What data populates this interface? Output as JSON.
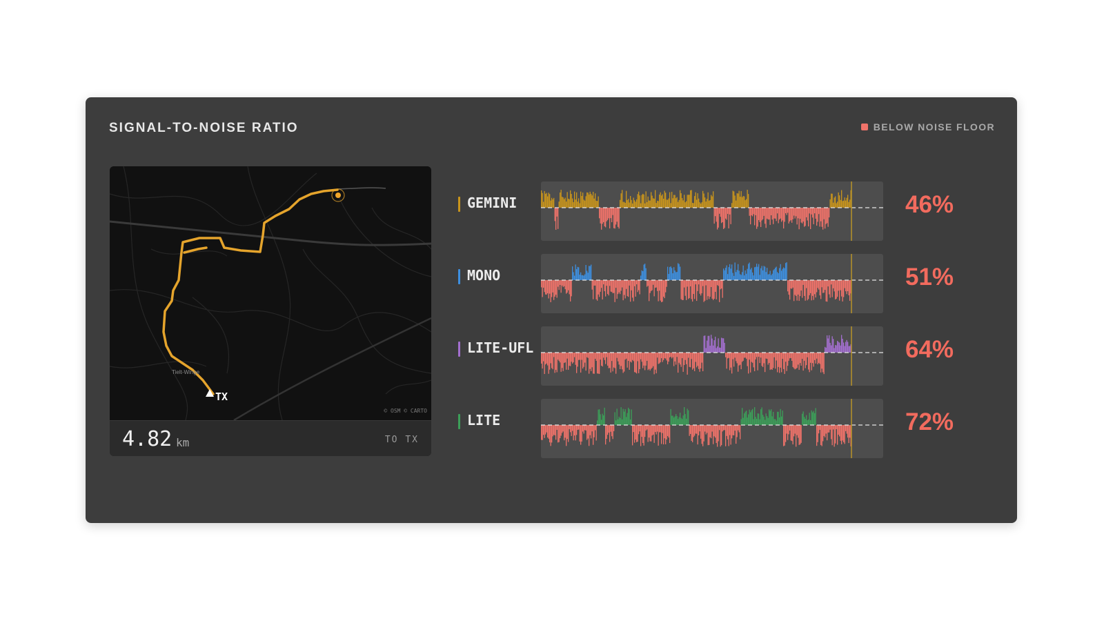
{
  "title": "SIGNAL-TO-NOISE RATIO",
  "legend": {
    "label": "BELOW NOISE FLOOR",
    "color": "#f0736a"
  },
  "map": {
    "distance": "4.82",
    "unit": "km",
    "to_label": "TO TX",
    "tx_label": "TX",
    "attribution": "© OSM © CARTO",
    "town_label": "Tielt-Winge",
    "route_color": "#e5a42c"
  },
  "rows": [
    {
      "name": "GEMINI",
      "percent": "46%",
      "color": "#c9951c"
    },
    {
      "name": "MONO",
      "percent": "51%",
      "color": "#3d8fe0"
    },
    {
      "name": "LITE-UFL",
      "percent": "64%",
      "color": "#a36fcf"
    },
    {
      "name": "LITE",
      "percent": "72%",
      "color": "#3c9f59"
    }
  ],
  "below_color": "#f0736a",
  "marker_color": "#b8932a"
}
